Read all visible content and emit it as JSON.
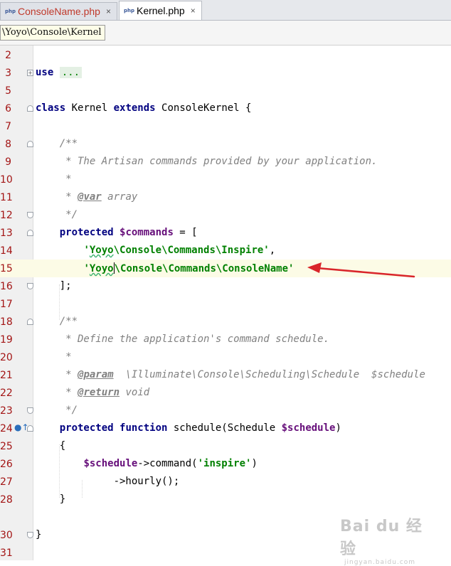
{
  "tabs": [
    {
      "label": "ConsoleName.php",
      "icon": "php-file-icon",
      "modified": true,
      "active": false
    },
    {
      "label": "Kernel.php",
      "icon": "php-file-icon",
      "modified": false,
      "active": true
    }
  ],
  "tab_close_glyph": "×",
  "breadcrumb": "\\Yoyo\\Console\\Kernel",
  "gutter": {
    "line_numbers": [
      "2",
      "3",
      "5",
      "6",
      "7",
      "8",
      "9",
      "10",
      "11",
      "12",
      "13",
      "14",
      "15",
      "16",
      "17",
      "18",
      "19",
      "20",
      "21",
      "22",
      "23",
      "24",
      "25",
      "26",
      "27",
      "28",
      "30",
      "31"
    ]
  },
  "code": {
    "l3_kw": "use",
    "l3_dots": "...",
    "l6_kw1": "class",
    "l6_name": " Kernel ",
    "l6_kw2": "extends",
    "l6_rest": " ConsoleKernel {",
    "l8": "    /**",
    "l9": "     * The Artisan commands provided by your application.",
    "l10": "     *",
    "l11_pre": "     * ",
    "l11_tag": "@var",
    "l11_rest": " array",
    "l12": "     */",
    "l13_pre": "    ",
    "l13_kw": "protected",
    "l13_sp": " ",
    "l13_var": "$commands",
    "l13_rest": " = [",
    "l14_pre": "        ",
    "l14_q": "'",
    "l14_typo": "Yoyo",
    "l14_rest": "\\Console\\Commands\\Inspire'",
    "l14_comma": ",",
    "l15_pre": "        ",
    "l15_q": "'",
    "l15_typo": "Yoyo",
    "l15_rest": "\\Console\\Commands\\ConsoleName'",
    "l16": "    ];",
    "l18": "    /**",
    "l19": "     * Define the application's command schedule.",
    "l20": "     *",
    "l21_pre": "     * ",
    "l21_tag": "@param",
    "l21_rest": "  \\Illuminate\\Console\\Scheduling\\Schedule  $schedule",
    "l22_pre": "     * ",
    "l22_tag": "@return",
    "l22_rest": " void",
    "l23": "     */",
    "l24_pre": "    ",
    "l24_kw1": "protected",
    "l24_sp": " ",
    "l24_kw2": "function",
    "l24_rest": " schedule(Schedule ",
    "l24_var": "$schedule",
    "l24_end": ")",
    "l25": "    {",
    "l26_pre": "        ",
    "l26_var": "$schedule",
    "l26_mid": "->command(",
    "l26_str": "'inspire'",
    "l26_end": ")",
    "l27": "             ->hourly();",
    "l28": "    }",
    "l30": "}"
  },
  "colors": {
    "line_number": "#a31515",
    "keyword": "#000080",
    "string": "#008000",
    "variable": "#660e7a",
    "comment": "#808080",
    "arrow": "#d9252a"
  },
  "watermark": {
    "logo": "Bai du 经验",
    "sub": "jingyan.baidu.com"
  }
}
